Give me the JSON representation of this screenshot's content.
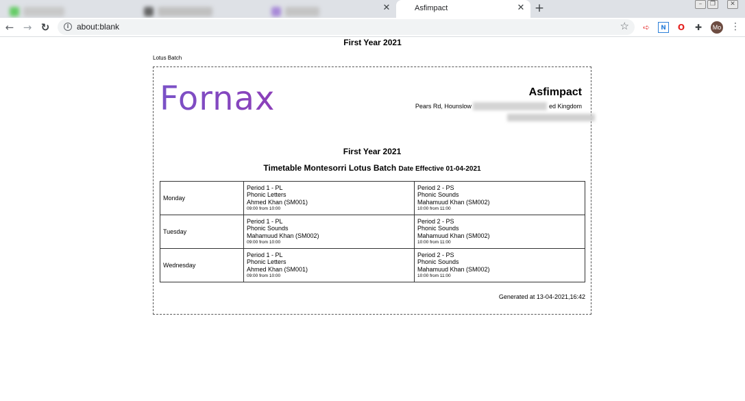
{
  "browser": {
    "active_tab_title": "Asfimpact",
    "url": "about:blank",
    "avatar_initials": "Mo"
  },
  "page": {
    "title": "First Year 2021",
    "batch_label": "Lotus Batch"
  },
  "report": {
    "logo_text": "Fornax",
    "company_name": "Asfimpact",
    "address_start": "Pears Rd, Hounslow",
    "address_end": "ed Kingdom",
    "year_title": "First Year 2021",
    "timetable_title": "Timetable Montesorri Lotus Batch",
    "date_effective": "Date Effective 01-04-2021",
    "generated": "Generated at 13-04-2021,16:42"
  },
  "timetable": [
    {
      "day": "Monday",
      "periods": [
        {
          "period": "Period 1 - PL",
          "subject": "Phonic Letters",
          "teacher": "Ahmed Khan (SM001)",
          "time": "09:00 from 10:00"
        },
        {
          "period": "Period 2 - PS",
          "subject": "Phonic Sounds",
          "teacher": "Mahamuud Khan (SM002)",
          "time": "10:00 from 11:00"
        }
      ]
    },
    {
      "day": "Tuesday",
      "periods": [
        {
          "period": "Period 1 - PL",
          "subject": "Phonic Sounds",
          "teacher": "Mahamuud Khan (SM002)",
          "time": "09:00 from 10:00"
        },
        {
          "period": "Period 2 - PS",
          "subject": "Phonic Sounds",
          "teacher": "Mahamuud Khan (SM002)",
          "time": "10:00 from 11:00"
        }
      ]
    },
    {
      "day": "Wednesday",
      "periods": [
        {
          "period": "Period 1 - PL",
          "subject": "Phonic Letters",
          "teacher": "Ahmed Khan (SM001)",
          "time": "09:00 from 10:00"
        },
        {
          "period": "Period 2 - PS",
          "subject": "Phonic Sounds",
          "teacher": "Mahamuud Khan (SM002)",
          "time": "10:00 from 11:00"
        }
      ]
    }
  ],
  "icons": {
    "back": "back-arrow-icon",
    "forward": "forward-arrow-icon",
    "reload": "reload-icon",
    "info": "info-icon",
    "star": "bookmark-star-icon",
    "extensions": "puzzle-icon",
    "menu": "kebab-menu-icon"
  },
  "colors": {
    "logo_purple": "#7a52c7",
    "tabstrip": "#dee1e6",
    "omnibox": "#f1f3f4"
  }
}
